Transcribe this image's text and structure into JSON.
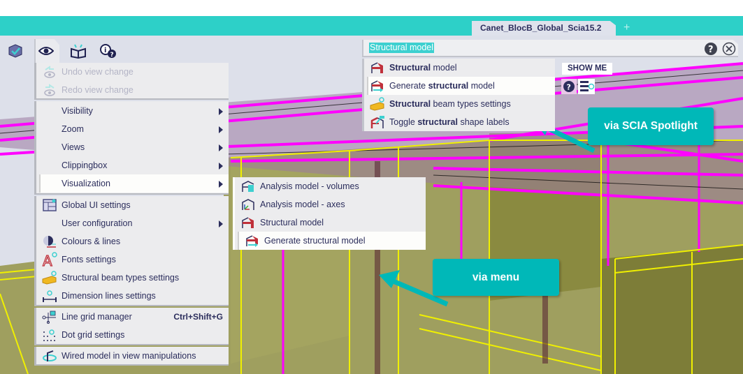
{
  "window": {
    "document_tab": "Canet_BlocB_Global_Scia15.2",
    "new_tab_symbol": "+"
  },
  "toolbar": {
    "icons": [
      "checked-cube-icon",
      "eye-icon",
      "open-book-icon",
      "info-help-icon"
    ]
  },
  "view_menu": {
    "items": [
      {
        "label": "Undo view change",
        "icon": "undo-view-icon",
        "disabled": true
      },
      {
        "label": "Redo view change",
        "icon": "redo-view-icon",
        "disabled": true
      },
      {
        "label": "Visibility",
        "submenu": true
      },
      {
        "label": "Zoom",
        "submenu": true
      },
      {
        "label": "Views",
        "submenu": true
      },
      {
        "label": "Clippingbox",
        "submenu": true
      },
      {
        "label": "Visualization",
        "submenu": true,
        "highlighted": true
      },
      {
        "label": "Global UI settings",
        "icon": "global-ui-settings-icon"
      },
      {
        "label": "User configuration",
        "submenu": true
      },
      {
        "label": "Colours & lines",
        "icon": "colours-lines-icon"
      },
      {
        "label": "Fonts settings",
        "icon": "fonts-settings-icon"
      },
      {
        "label": "Structural beam types settings",
        "icon": "beam-types-icon"
      },
      {
        "label": "Dimension lines settings",
        "icon": "dimension-lines-icon"
      },
      {
        "label": "Line grid manager",
        "icon": "line-grid-icon",
        "shortcut": "Ctrl+Shift+G"
      },
      {
        "label": "Dot grid settings",
        "icon": "dot-grid-icon"
      },
      {
        "label": "Wired model in view manipulations",
        "icon": "wired-model-icon"
      }
    ]
  },
  "visualization_submenu": {
    "items": [
      {
        "label": "Analysis model - volumes",
        "icon": "analysis-volumes-icon"
      },
      {
        "label": "Analysis model - axes",
        "icon": "analysis-axes-icon"
      },
      {
        "label": "Structural model",
        "icon": "structural-model-icon"
      },
      {
        "label": "Generate structural model",
        "icon": "generate-structural-model-icon",
        "highlighted": true
      }
    ]
  },
  "spotlight": {
    "query": "Structural model",
    "results": [
      {
        "pre": "",
        "bold": "Structural",
        "post": " model"
      },
      {
        "pre": "Generate ",
        "bold": "structural",
        "post": " model",
        "highlighted": true
      },
      {
        "pre": "",
        "bold": "Structural",
        "post": " beam types settings"
      },
      {
        "pre": "Toggle ",
        "bold": "structural",
        "post": " shape labels"
      }
    ],
    "show_me_label": "SHOW ME"
  },
  "callouts": {
    "spotlight": "via SCIA Spotlight",
    "menu": "via menu"
  },
  "colors": {
    "accent": "#2dd0c8",
    "callout": "#00b8b8",
    "text": "#2b2d5c",
    "structure_magenta": "#ff00ff",
    "structure_yellow": "#f0f000"
  }
}
